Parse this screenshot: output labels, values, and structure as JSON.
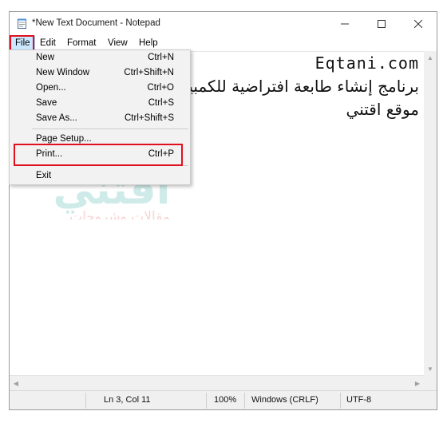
{
  "window": {
    "title": "*New Text Document - Notepad"
  },
  "menubar": {
    "items": [
      "File",
      "Edit",
      "Format",
      "View",
      "Help"
    ]
  },
  "file_menu": {
    "items": [
      {
        "label": "New",
        "shortcut": "Ctrl+N"
      },
      {
        "label": "New Window",
        "shortcut": "Ctrl+Shift+N"
      },
      {
        "label": "Open...",
        "shortcut": "Ctrl+O"
      },
      {
        "label": "Save",
        "shortcut": "Ctrl+S"
      },
      {
        "label": "Save As...",
        "shortcut": "Ctrl+Shift+S"
      },
      {
        "label": "Page Setup...",
        "shortcut": ""
      },
      {
        "label": "Print...",
        "shortcut": "Ctrl+P"
      },
      {
        "label": "Exit",
        "shortcut": ""
      }
    ]
  },
  "editor": {
    "lines": [
      "Eqtani.com",
      "برنامج إنشاء طابعة افتراضية للكمبيوتر",
      "موقع اقتني"
    ]
  },
  "statusbar": {
    "position": "Ln 3, Col 11",
    "zoom": "100%",
    "line_ending": "Windows (CRLF)",
    "encoding": "UTF-8"
  },
  "watermark": {
    "brand_text": "اقتني",
    "tagline": "مقالات وشروحات"
  },
  "colors": {
    "highlight": "#e0101e",
    "menu_selected": "#cce8ff",
    "watermark_red": "#e03a3a",
    "watermark_teal": "#2aa7a0"
  },
  "icons": {
    "app": "notepad-icon",
    "minimize": "minimize-icon",
    "maximize": "maximize-icon",
    "close": "close-icon"
  }
}
